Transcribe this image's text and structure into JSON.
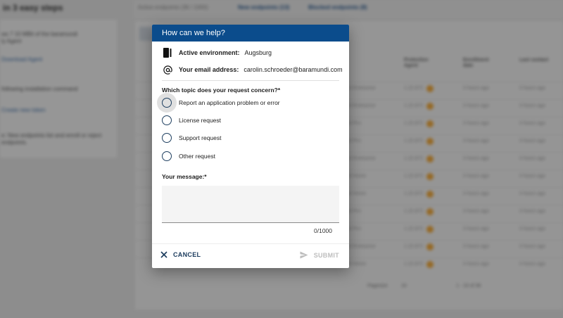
{
  "background": {
    "left_title": "in 3 easy steps",
    "left_lines": [
      "ws 7 10 MBit of the baramundi",
      "ly Agent",
      "Download Agent",
      "following installation command",
      "Create new token",
      "e: New endpoints list and enroll or reject",
      "endpoints."
    ],
    "tabs": [
      "Active endpoints (36 / 1000)",
      "New endpoints (13)",
      "Blocked endpoints (8)"
    ],
    "columns": [
      "Protection Agent",
      "Enrollment date",
      "Last contact"
    ],
    "row_version": "1.22.872",
    "row_age": "0 hours ago",
    "row_os": [
      "10 Enterprise",
      "10 Enterprise",
      "10 Pro",
      "10 Pro",
      "10 Enterprise",
      "10 Home",
      "10 Home",
      "10 Pro",
      "10 Pro",
      "10 Enterprise",
      "10 Home"
    ],
    "pager_label": "Pagesize",
    "pager_size": "10",
    "pager_range": "1 - 10 of 36"
  },
  "dialog": {
    "title": "How can we help?",
    "environment_label": "Active environment:",
    "environment_value": "Augsburg",
    "email_label": "Your email address:",
    "email_value": "carolin.schroeder@baramundi.com",
    "topic_question": "Which topic does your request concern?*",
    "topics": [
      "Report an application problem or error",
      "License request",
      "Support request",
      "Other request"
    ],
    "message_label": "Your message:*",
    "message_value": "",
    "char_counter": "0/1000",
    "cancel_label": "CANCEL",
    "submit_label": "SUBMIT"
  },
  "colors": {
    "header_bg": "#0b4c8c",
    "accent": "#1a3a5c",
    "disabled": "#bdbdbd",
    "status_dot": "#f0a93b"
  },
  "icons": {
    "environment": "server-icon",
    "email": "at-icon",
    "cancel": "close-icon",
    "submit": "send-icon"
  }
}
